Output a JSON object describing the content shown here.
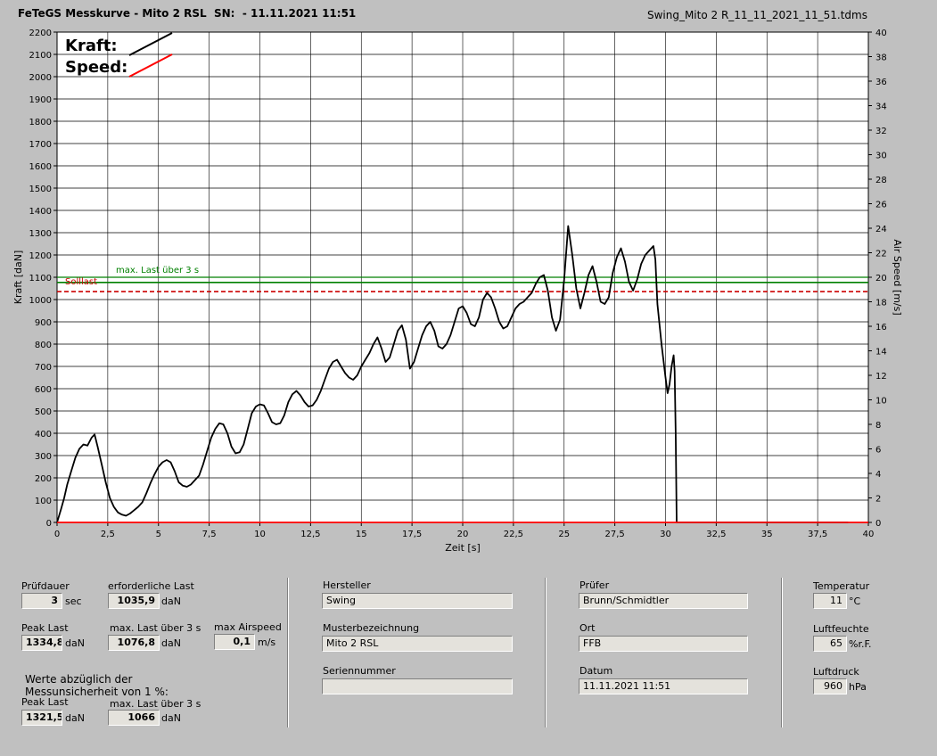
{
  "header": {
    "title": "FeTeGS Messkurve - Mito 2 RSL  SN:  - 11.11.2021 11:51",
    "filename": "Swing_Mito 2 R_11_11_2021_11_51.tdms"
  },
  "colors": {
    "kraft": "#000000",
    "speed": "#ff0000",
    "maxlast": "#008000",
    "solllast": "#cc0000",
    "plot_bg": "#ffffff",
    "grid": "#000000"
  },
  "chart_data": {
    "type": "line",
    "xlabel": "Zeit [s]",
    "ylabel_left": "Kraft [daN]",
    "ylabel_right": "Air Speed [m/s]",
    "xlim": [
      0,
      40
    ],
    "ylim_left": [
      0,
      2200
    ],
    "ylim_right": [
      0,
      40
    ],
    "x_ticks": [
      "0",
      "2,5",
      "5",
      "7,5",
      "10",
      "12,5",
      "15",
      "17,5",
      "20",
      "22,5",
      "25",
      "27,5",
      "30",
      "32,5",
      "35",
      "37,5",
      "40"
    ],
    "y_ticks_left": [
      "0",
      "100",
      "200",
      "300",
      "400",
      "500",
      "600",
      "700",
      "800",
      "900",
      "1000",
      "1100",
      "1200",
      "1300",
      "1400",
      "1500",
      "1600",
      "1700",
      "1800",
      "1900",
      "2000",
      "2100",
      "2200"
    ],
    "y_ticks_right": [
      "0",
      "2",
      "4",
      "6",
      "8",
      "10",
      "12",
      "14",
      "16",
      "18",
      "20",
      "22",
      "24",
      "26",
      "28",
      "30",
      "32",
      "34",
      "36",
      "38",
      "40"
    ],
    "grid": true,
    "legend": {
      "position": "top-left",
      "entries": [
        "Kraft:",
        "Speed:"
      ]
    },
    "reference_lines": [
      {
        "label": "max. Last über  3 s",
        "value": 1076.8,
        "style": "solid"
      },
      {
        "label": "Solllast",
        "value": 1035.9,
        "style": "dashed"
      },
      {
        "label": "",
        "value": 1100,
        "style": "solid"
      }
    ],
    "series": [
      {
        "name": "Kraft:",
        "axis": "left",
        "x": [
          0,
          0.2,
          0.35,
          0.5,
          0.7,
          0.9,
          1.1,
          1.3,
          1.5,
          1.7,
          1.85,
          2.0,
          2.2,
          2.4,
          2.6,
          2.8,
          3.0,
          3.2,
          3.4,
          3.6,
          3.8,
          4.0,
          4.2,
          4.4,
          4.6,
          4.8,
          5.0,
          5.2,
          5.4,
          5.6,
          5.8,
          6.0,
          6.2,
          6.4,
          6.6,
          6.8,
          7.0,
          7.2,
          7.4,
          7.6,
          7.8,
          8.0,
          8.2,
          8.4,
          8.6,
          8.8,
          9.0,
          9.2,
          9.4,
          9.6,
          9.8,
          10.0,
          10.2,
          10.4,
          10.6,
          10.8,
          11.0,
          11.2,
          11.4,
          11.6,
          11.8,
          12.0,
          12.2,
          12.4,
          12.6,
          12.8,
          13.0,
          13.2,
          13.4,
          13.6,
          13.8,
          14.0,
          14.2,
          14.4,
          14.6,
          14.8,
          15.0,
          15.2,
          15.4,
          15.6,
          15.8,
          16.0,
          16.2,
          16.4,
          16.6,
          16.8,
          17.0,
          17.2,
          17.4,
          17.6,
          17.8,
          18.0,
          18.2,
          18.4,
          18.6,
          18.8,
          19.0,
          19.2,
          19.4,
          19.6,
          19.8,
          20.0,
          20.2,
          20.4,
          20.6,
          20.8,
          21.0,
          21.2,
          21.4,
          21.6,
          21.8,
          22.0,
          22.2,
          22.4,
          22.6,
          22.8,
          23.0,
          23.2,
          23.4,
          23.6,
          23.8,
          24.0,
          24.2,
          24.4,
          24.6,
          24.8,
          25.0,
          25.2,
          25.4,
          25.6,
          25.8,
          26.0,
          26.2,
          26.4,
          26.6,
          26.8,
          27.0,
          27.2,
          27.4,
          27.6,
          27.8,
          28.0,
          28.2,
          28.4,
          28.6,
          28.8,
          29.0,
          29.2,
          29.4,
          29.5,
          29.6,
          29.8,
          30.0,
          30.1,
          30.2,
          30.3,
          30.4,
          30.45,
          30.5,
          30.55,
          31,
          32,
          33,
          34,
          35,
          36,
          37,
          38,
          39
        ],
        "y": [
          0,
          60,
          110,
          170,
          230,
          290,
          330,
          350,
          345,
          380,
          395,
          340,
          260,
          180,
          110,
          70,
          45,
          35,
          30,
          40,
          55,
          70,
          90,
          130,
          175,
          215,
          250,
          270,
          280,
          270,
          230,
          180,
          165,
          160,
          170,
          190,
          210,
          260,
          320,
          380,
          420,
          445,
          440,
          400,
          340,
          310,
          315,
          350,
          420,
          490,
          520,
          530,
          525,
          490,
          450,
          440,
          445,
          480,
          540,
          575,
          590,
          570,
          540,
          520,
          525,
          550,
          590,
          640,
          690,
          720,
          730,
          700,
          670,
          650,
          640,
          660,
          700,
          730,
          760,
          800,
          830,
          780,
          720,
          740,
          800,
          860,
          885,
          820,
          690,
          720,
          780,
          840,
          880,
          900,
          860,
          790,
          780,
          800,
          840,
          900,
          960,
          970,
          940,
          890,
          880,
          920,
          1000,
          1030,
          1010,
          960,
          900,
          870,
          880,
          920,
          960,
          980,
          990,
          1010,
          1030,
          1070,
          1100,
          1110,
          1040,
          920,
          860,
          910,
          1090,
          1330,
          1200,
          1050,
          960,
          1030,
          1110,
          1150,
          1080,
          990,
          980,
          1010,
          1120,
          1190,
          1230,
          1170,
          1080,
          1040,
          1090,
          1160,
          1200,
          1220,
          1240,
          1180,
          980,
          800,
          650,
          580,
          620,
          700,
          750,
          680,
          400,
          0,
          0,
          0,
          0,
          0,
          0,
          0,
          0,
          0,
          0
        ]
      },
      {
        "name": "Speed:",
        "axis": "right",
        "x": [
          0,
          30.5,
          40
        ],
        "y": [
          0,
          0,
          0
        ]
      }
    ]
  },
  "stats": {
    "pruefdauer_label": "Prüfdauer",
    "pruefdauer_value": "3",
    "pruefdauer_unit": "sec",
    "erf_last_label": "erforderliche Last",
    "erf_last_value": "1035,9",
    "erf_last_unit": "daN",
    "peak_last_label": "Peak Last",
    "peak_last_value": "1334,8",
    "peak_last_unit": "daN",
    "max_last_label": "max. Last über  3 s",
    "max_last_value": "1076,8",
    "max_last_unit": "daN",
    "max_airspeed_label": "max Airspeed",
    "max_airspeed_value": "0,1",
    "max_airspeed_unit": "m/s",
    "note_line1": "Werte abzüglich der",
    "note_line2": "Messunsicherheit von 1  %:",
    "peak_last2_label": "Peak Last",
    "peak_last2_value": "1321,5",
    "peak_last2_unit": "daN",
    "max_last2_label": "max. Last über  3 s",
    "max_last2_value": "1066",
    "max_last2_unit": "daN"
  },
  "info": {
    "hersteller_label": "Hersteller",
    "hersteller_value": "Swing",
    "muster_label": "Musterbezeichnung",
    "muster_value": "Mito 2 RSL",
    "serien_label": "Seriennummer",
    "serien_value": "",
    "pruefer_label": "Prüfer",
    "pruefer_value": "Brunn/Schmidtler",
    "ort_label": "Ort",
    "ort_value": "FFB",
    "datum_label": "Datum",
    "datum_value": "11.11.2021 11:51"
  },
  "env": {
    "temp_label": "Temperatur",
    "temp_value": "11",
    "temp_unit": "°C",
    "feuchte_label": "Luftfeuchte",
    "feuchte_value": "65",
    "feuchte_unit": "%r.F.",
    "druck_label": "Luftdruck",
    "druck_value": "960",
    "druck_unit": "hPa"
  }
}
